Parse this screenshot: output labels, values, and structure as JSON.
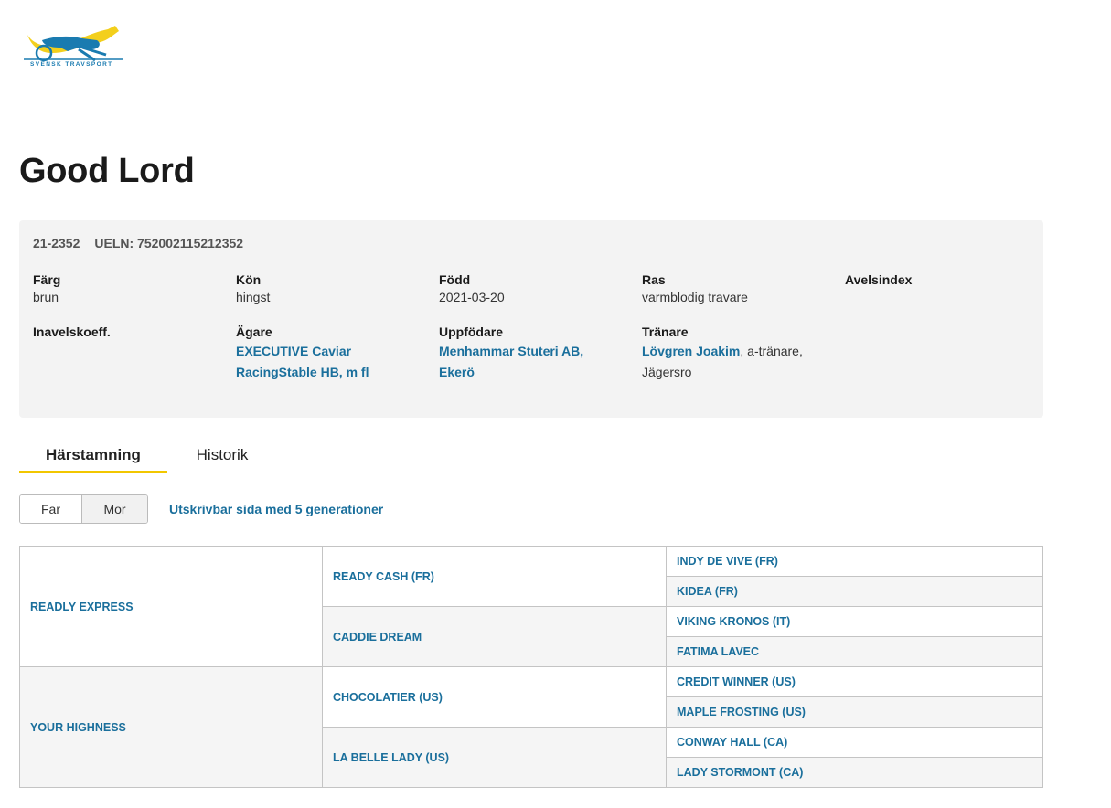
{
  "brand": {
    "logo_text": "SVENSK TRAVSPORT"
  },
  "horse": {
    "name": "Good Lord",
    "reg_no": "21-2352",
    "ueln": "UELN: 752002115212352"
  },
  "info": {
    "farg": {
      "label": "Färg",
      "value": "brun"
    },
    "kon": {
      "label": "Kön",
      "value": "hingst"
    },
    "fodd": {
      "label": "Född",
      "value": "2021-03-20"
    },
    "ras": {
      "label": "Ras",
      "value": "varmblodig travare"
    },
    "avelsindex": {
      "label": "Avelsindex"
    },
    "inavel": {
      "label": "Inavelskoeff."
    },
    "agare": {
      "label": "Ägare",
      "line1": "EXECUTIVE Caviar",
      "line2": "RacingStable HB, m fl"
    },
    "uppfodare": {
      "label": "Uppfödare",
      "line1": "Menhammar Stuteri AB,",
      "line2": "Ekerö"
    },
    "tranare": {
      "label": "Tränare",
      "name": "Lövgren Joakim",
      "suffix": ", a-tränare,",
      "place": "Jägersro"
    }
  },
  "tabs": [
    "Härstamning",
    "Historik"
  ],
  "toggle": {
    "far": "Far",
    "mor": "Mor"
  },
  "print_link": "Utskrivbar sida med 5 generationer",
  "pedigree": {
    "sire": "READLY EXPRESS",
    "dam": "YOUR HIGHNESS",
    "g2": [
      "READY CASH (FR)",
      "CADDIE DREAM",
      "CHOCOLATIER (US)",
      "LA BELLE LADY (US)"
    ],
    "g3": [
      "INDY DE VIVE (FR)",
      "KIDEA (FR)",
      "VIKING KRONOS (IT)",
      "FATIMA LAVEC",
      "CREDIT WINNER (US)",
      "MAPLE FROSTING (US)",
      "CONWAY HALL (CA)",
      "LADY STORMONT (CA)"
    ]
  }
}
